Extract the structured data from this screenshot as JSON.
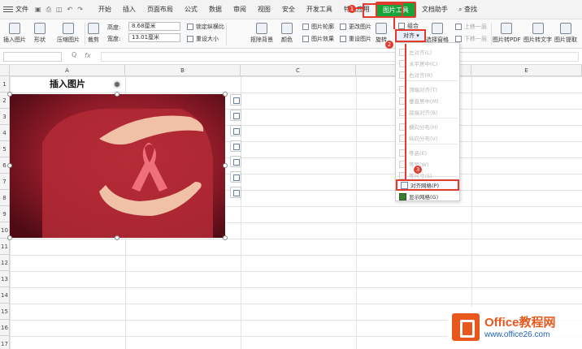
{
  "menubar": {
    "file": "文件",
    "tabs": [
      {
        "label": "开始"
      },
      {
        "label": "插入"
      },
      {
        "label": "页面布局"
      },
      {
        "label": "公式"
      },
      {
        "label": "数据"
      },
      {
        "label": "审阅"
      },
      {
        "label": "视图"
      },
      {
        "label": "安全"
      },
      {
        "label": "开发工具"
      },
      {
        "label": "特色应用"
      },
      {
        "label": "图片工具"
      },
      {
        "label": "文档助手"
      }
    ],
    "active_tab": "图片工具",
    "search": "查找"
  },
  "ribbon": {
    "insert_picture": "插入图片",
    "shape": "形状",
    "compress": "压缩图片",
    "crop": "裁剪",
    "height_label": "高度:",
    "height_value": "8.68厘米",
    "width_label": "宽度:",
    "width_value": "13.01厘米",
    "lock_ratio": "锁定纵横比",
    "reset_size": "重设大小",
    "remove_bg": "抠除背景",
    "color": "颜色",
    "outline": "图片轮廓",
    "effects": "图片效果",
    "change_pic": "更改图片",
    "reset_pic": "重设图片",
    "rotate": "旋转",
    "align": "对齐",
    "group": "组合",
    "selection_pane": "选择窗格",
    "bring_forward": "上移一层",
    "send_backward": "下移一层",
    "to_pdf": "图片转PDF",
    "to_text": "图片转文字",
    "extract": "图片提取"
  },
  "formula_bar": {
    "fx": "fx",
    "zoom": "Q"
  },
  "sheet": {
    "columns": [
      "A",
      "B",
      "C",
      "D",
      "E"
    ],
    "rows": [
      "1",
      "2",
      "3",
      "4",
      "5",
      "6",
      "7",
      "8",
      "9",
      "10",
      "11",
      "12",
      "13",
      "14",
      "15",
      "16",
      "17"
    ],
    "a1": "插入图片"
  },
  "dropdown": {
    "items": [
      {
        "label": "左对齐(L)",
        "enabled": false
      },
      {
        "label": "水平居中(C)",
        "enabled": false
      },
      {
        "label": "右对齐(R)",
        "enabled": false
      },
      {
        "label": "顶端对齐(T)",
        "enabled": false
      },
      {
        "label": "垂直居中(M)",
        "enabled": false
      },
      {
        "label": "底端对齐(B)",
        "enabled": false
      },
      {
        "label": "横向分布(H)",
        "enabled": false
      },
      {
        "label": "纵向分布(V)",
        "enabled": false
      },
      {
        "label": "等高(E)",
        "enabled": false
      },
      {
        "label": "等宽(W)",
        "enabled": false
      },
      {
        "label": "等尺寸(S)",
        "enabled": false
      },
      {
        "label": "对齐网格(P)",
        "enabled": true
      },
      {
        "label": "显示网格(G)",
        "enabled": true
      }
    ]
  },
  "annotations": {
    "b1": "1",
    "b2": "2",
    "b3": "3"
  },
  "watermark": {
    "brand": "Office教程网",
    "url": "www.office26.com"
  },
  "colors": {
    "accent": "#17a339",
    "annotation": "#e23b2e",
    "brand": "#e8581d",
    "link": "#1e63b5"
  }
}
